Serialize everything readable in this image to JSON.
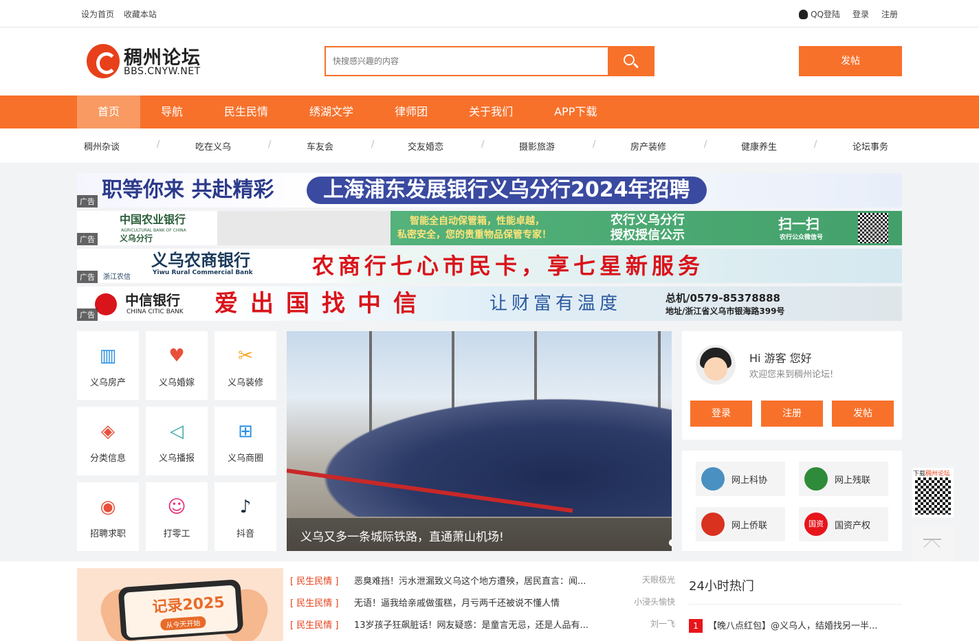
{
  "topbar": {
    "set_home": "设为首页",
    "bookmark": "收藏本站",
    "qq_login": "QQ登陆",
    "login": "登录",
    "register": "注册"
  },
  "logo": {
    "name": "稠州论坛",
    "url": "BBS.CNYW.NET"
  },
  "search": {
    "placeholder": "快搜感兴趣的内容",
    "value": ""
  },
  "header": {
    "post_label": "发帖"
  },
  "nav": {
    "items": [
      "首页",
      "导航",
      "民生民情",
      "绣湖文学",
      "律师团",
      "关于我们",
      "APP下载"
    ],
    "active": "首页"
  },
  "subnav": {
    "items": [
      "稠州杂谈",
      "吃在义乌",
      "车友会",
      "交友婚恋",
      "摄影旅游",
      "房产装修",
      "健康养生",
      "论坛事务"
    ],
    "separator": "/"
  },
  "ads": {
    "tag": "广告",
    "ad1": {
      "left": "职等你来 共赴精彩",
      "right": "上海浦东发展银行义乌分行2024年招聘"
    },
    "ad2": {
      "bank": "中国农业银行",
      "bank_en": "AGRICULTURAL BANK OF CHINA",
      "branch": "义乌分行",
      "slogan1": "智能全自动保管箱，性能卓越，",
      "slogan2": "私密安全，您的贵重物品保管专家！",
      "notice1": "农行义乌分行",
      "notice2": "授权授信公示",
      "scan": "扫一扫",
      "scan_sub": "农行公众微信号"
    },
    "ad3": {
      "bank": "义乌农商银行",
      "bank_en": "Yiwu Rural Commercial Bank",
      "sub": "浙江农信",
      "slogan": "农商行七心市民卡，享七星新服务"
    },
    "ad4": {
      "bank": "中信银行",
      "bank_en": "CHINA CITIC BANK",
      "slogan": "爱出国找中信",
      "slogan2": "让财富有温度",
      "phone": "总机/0579-85378888",
      "address": "地址/浙江省义乌市银海路399号"
    }
  },
  "tiles": [
    {
      "label": "义乌房产",
      "icon": "building-icon",
      "color": "#2a8fe0"
    },
    {
      "label": "义乌婚嫁",
      "icon": "couple-icon",
      "color": "#e8503a"
    },
    {
      "label": "义乌装修",
      "icon": "tools-icon",
      "color": "#f5a623"
    },
    {
      "label": "分类信息",
      "icon": "layers-icon",
      "color": "#e8503a"
    },
    {
      "label": "义乌播报",
      "icon": "megaphone-icon",
      "color": "#3aa7a0"
    },
    {
      "label": "义乌商圈",
      "icon": "shop-icon",
      "color": "#2a8fe0"
    },
    {
      "label": "招聘求职",
      "icon": "hire-icon",
      "color": "#e8503a"
    },
    {
      "label": "打零工",
      "icon": "worker-icon",
      "color": "#e8307a"
    },
    {
      "label": "抖音",
      "icon": "tiktok-icon",
      "color": "#1a2a3a"
    }
  ],
  "slider": {
    "caption": "义乌又多一条城际铁路，直通萧山机场!",
    "dots": 5,
    "active_dot": 2
  },
  "user": {
    "greeting": "Hi 游客 您好",
    "welcome": "欢迎您来到稠州论坛!",
    "login": "登录",
    "register": "注册",
    "post": "发帖"
  },
  "links": [
    {
      "label": "网上科协",
      "icon": "kexie-icon",
      "color": "#4a90c0"
    },
    {
      "label": "网上残联",
      "icon": "canlian-icon",
      "color": "#2e8b3a"
    },
    {
      "label": "网上侨联",
      "icon": "qiaolian-icon",
      "color": "#d9321f"
    },
    {
      "label": "国资产权",
      "icon": "guozi-icon",
      "color": "#e8141b",
      "badge": "国资"
    }
  ],
  "qr": {
    "prefix": "下载",
    "brand": "稠州论坛"
  },
  "promo": {
    "title": "记录2025",
    "button": "从今天开始"
  },
  "news": [
    {
      "category": "[ 民生民情 ]",
      "title": "恶臭难挡！污水泄漏致义乌这个地方遭殃，居民直言：闻...",
      "author": "天眼极光"
    },
    {
      "category": "[ 民生民情 ]",
      "title": "无语！逼我给亲戚做蛋糕，月亏两千还被说不懂人情",
      "author": "小浸头愉快"
    },
    {
      "category": "[ 民生民情 ]",
      "title": "13岁孩子狂飙脏话！网友疑惑：是童言无忌，还是人品有...",
      "author": "刘一飞"
    }
  ],
  "hot": {
    "heading": "24小时热门",
    "items": [
      {
        "rank": "1",
        "title": "【晚八点红包】@义乌人，结婚找另一半..."
      }
    ]
  }
}
